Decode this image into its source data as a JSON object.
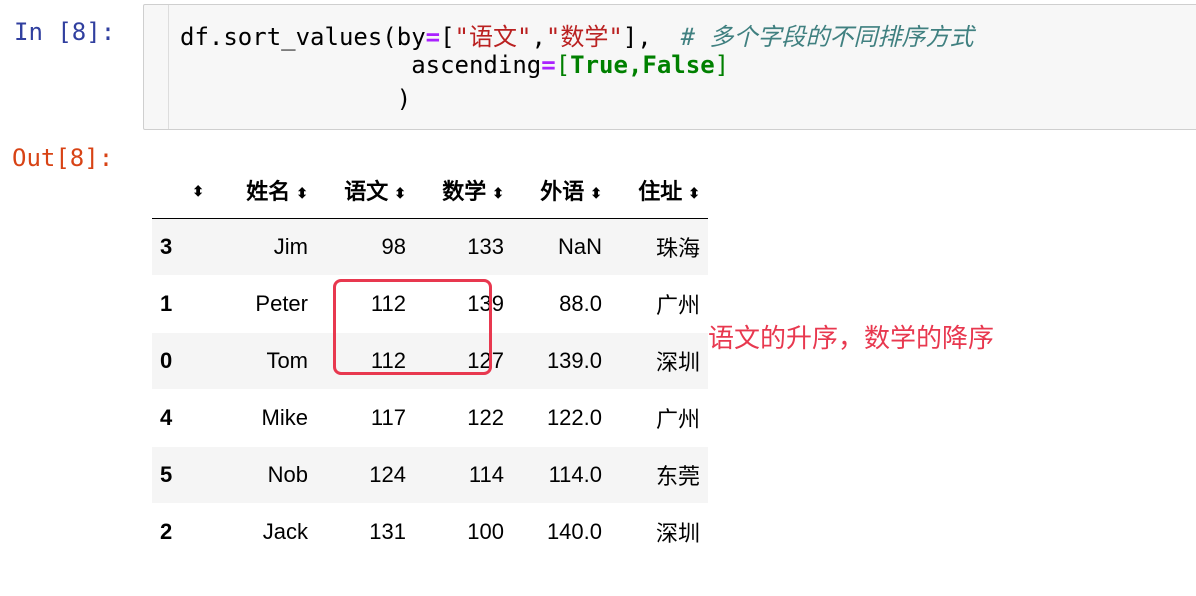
{
  "input_prompt": "In [8]:",
  "output_prompt": "Out[8]:",
  "code": {
    "line1": {
      "p1": "df.sort_values(by",
      "op": "=",
      "p2": "[",
      "s1": "\"语文\"",
      "p3": ",",
      "s2": "\"数学\"",
      "p4": "],  ",
      "comment": "# 多个字段的不同排序方式"
    },
    "line2": {
      "indent": "                ",
      "p1": "ascending",
      "op": "=",
      "p2": "[",
      "k1": "True",
      "p3": ",",
      "k2": "False",
      "p4": "]"
    },
    "line3": {
      "indent": "               ",
      "p1": ")"
    }
  },
  "table": {
    "columns": [
      "",
      "姓名",
      "语文",
      "数学",
      "外语",
      "住址"
    ],
    "sort_icon": "⬍",
    "rows": [
      {
        "index": "3",
        "name": "Jim",
        "chinese": "98",
        "math": "133",
        "foreign": "NaN",
        "address": "珠海"
      },
      {
        "index": "1",
        "name": "Peter",
        "chinese": "112",
        "math": "139",
        "foreign": "88.0",
        "address": "广州"
      },
      {
        "index": "0",
        "name": "Tom",
        "chinese": "112",
        "math": "127",
        "foreign": "139.0",
        "address": "深圳"
      },
      {
        "index": "4",
        "name": "Mike",
        "chinese": "117",
        "math": "122",
        "foreign": "122.0",
        "address": "广州"
      },
      {
        "index": "5",
        "name": "Nob",
        "chinese": "124",
        "math": "114",
        "foreign": "114.0",
        "address": "东莞"
      },
      {
        "index": "2",
        "name": "Jack",
        "chinese": "131",
        "math": "100",
        "foreign": "140.0",
        "address": "深圳"
      }
    ]
  },
  "annotation": "语文的升序，数学的降序",
  "colors": {
    "annotation": "#e8384f",
    "input_prompt": "#303f9f",
    "output_prompt": "#d84315"
  }
}
